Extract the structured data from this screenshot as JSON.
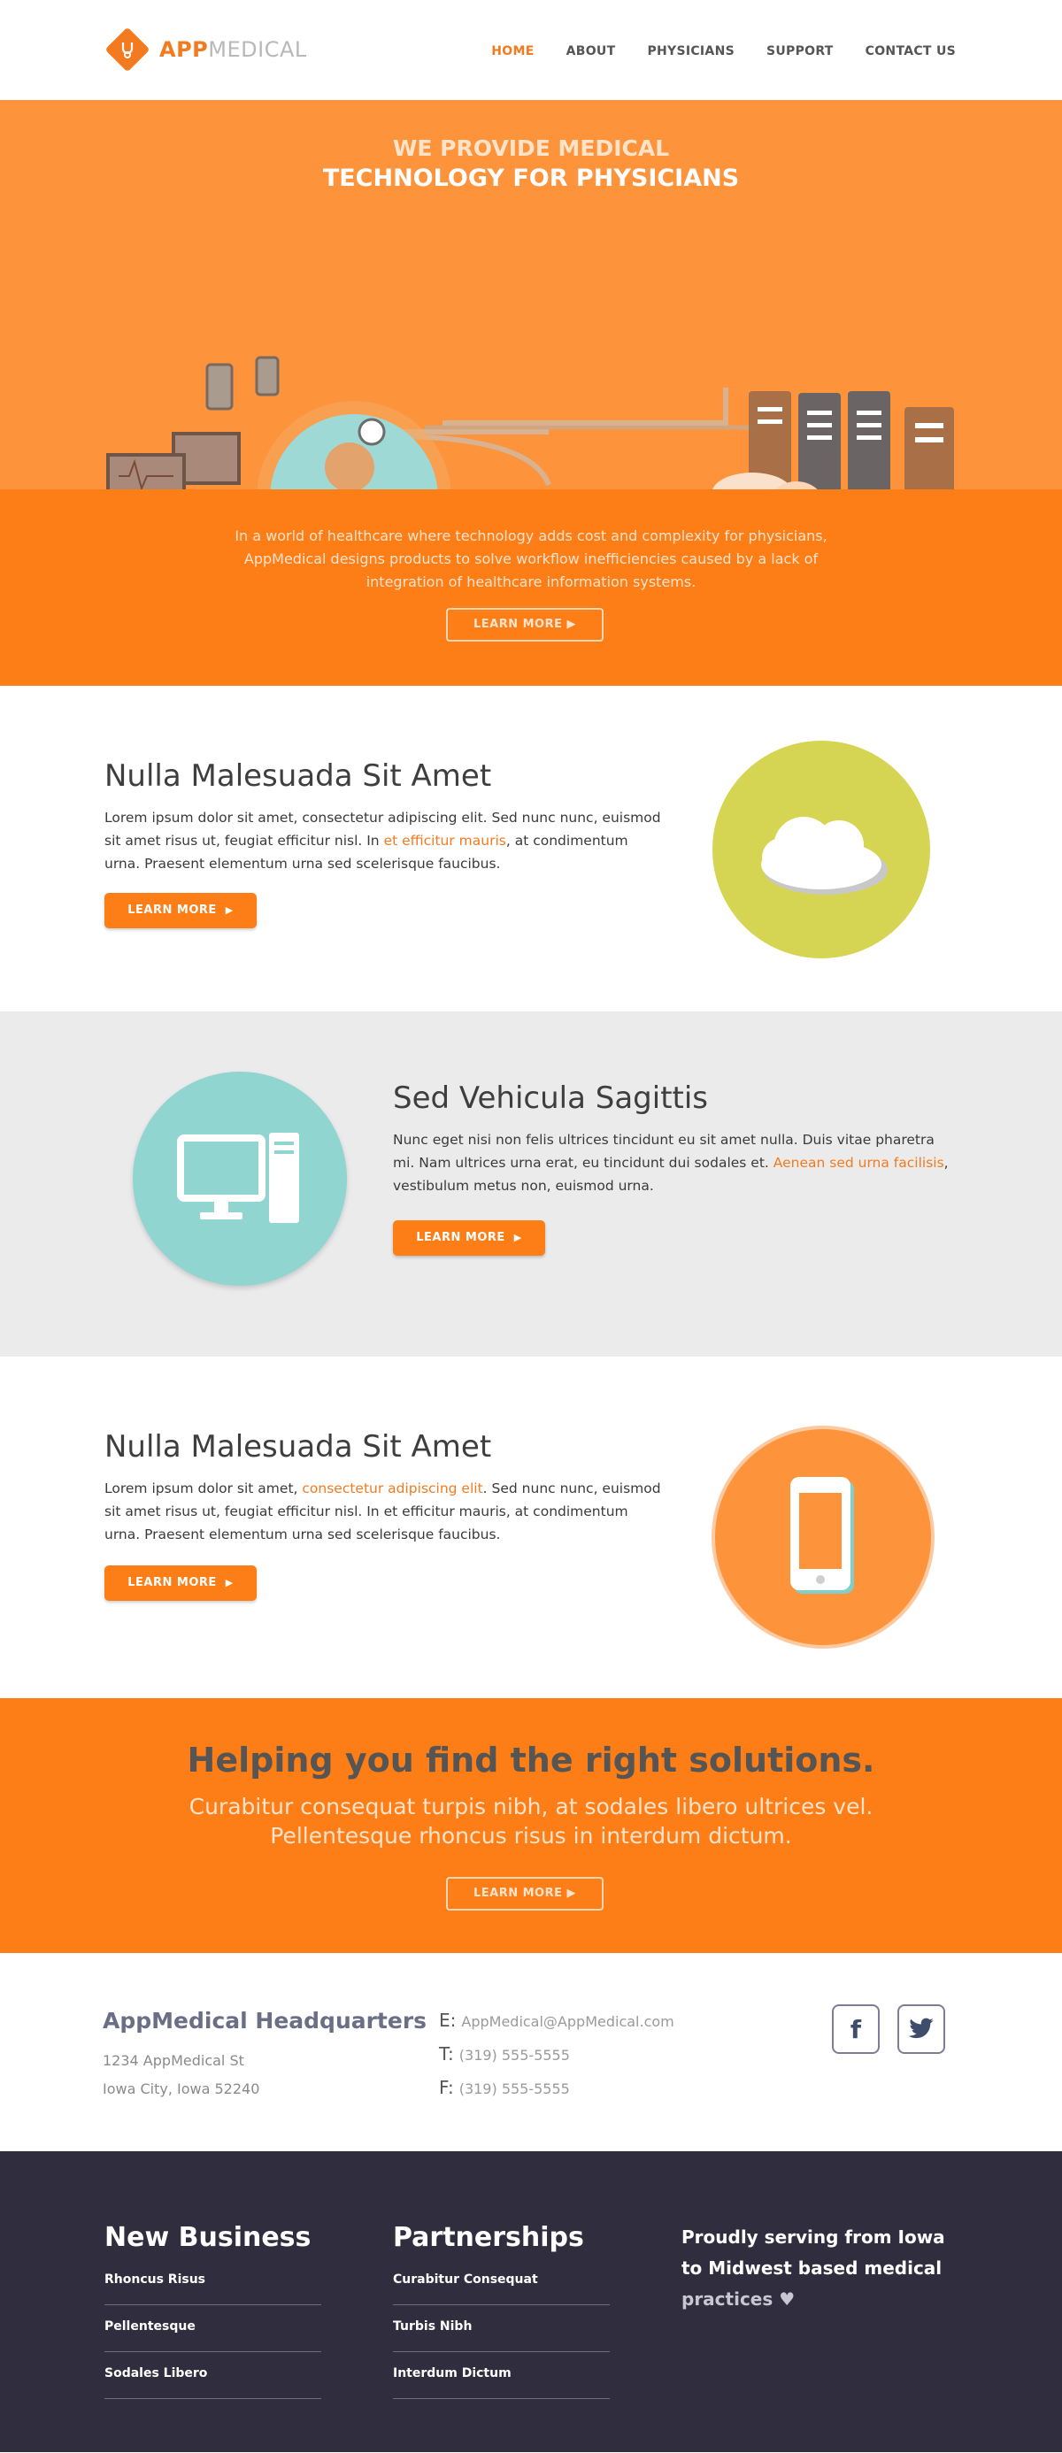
{
  "brand": {
    "name_a": "APP",
    "name_b": "MEDICAL",
    "accent": "#f47a1f"
  },
  "nav": [
    {
      "label": "HOME",
      "active": true
    },
    {
      "label": "ABOUT",
      "active": false
    },
    {
      "label": "PHYSICIANS",
      "active": false
    },
    {
      "label": "SUPPORT",
      "active": false
    },
    {
      "label": "CONTACT US",
      "active": false
    }
  ],
  "hero": {
    "line1": "WE PROVIDE MEDICAL",
    "line2": "TECHNOLOGY FOR PHYSICIANS",
    "body": "In a world of healthcare where technology adds cost and complexity for physicians, AppMedical designs products to solve workflow inefficiencies caused by a lack of integration of healthcare information systems.",
    "button": "LEARN MORE ▶"
  },
  "sections": [
    {
      "title": "Nulla Malesuada Sit Amet",
      "text_a": "Lorem ipsum dolor sit amet, consectetur adipiscing elit. Sed nunc nunc, euismod sit amet risus ut, feugiat efficitur nisl. In ",
      "text_hl": "et efficitur mauris",
      "text_b": ", at condimentum urna. Praesent elementum urna sed scelerisque faucibus.",
      "button": "LEARN MORE",
      "icon": "cloud-icon",
      "circle_color": "#d5d553"
    },
    {
      "title": "Sed Vehicula Sagittis",
      "text_a": "Nunc eget nisi non felis ultrices tincidunt eu sit amet nulla. Duis vitae pharetra mi. Nam ultrices urna erat, eu tincidunt dui sodales et. ",
      "text_hl": "Aenean sed urna facilisis",
      "text_b": ", vestibulum metus non, euismod urna.",
      "button": "LEARN MORE",
      "icon": "desktop-computer-icon",
      "circle_color": "#91d5d1"
    },
    {
      "title": "Nulla Malesuada Sit Amet",
      "text_a": "Lorem ipsum dolor sit amet, ",
      "text_hl": "consectetur adipiscing elit",
      "text_b": ". Sed nunc nunc, euismod sit amet risus ut, feugiat efficitur nisl. In et efficitur mauris, at condimentum urna. Praesent elementum urna sed scelerisque faucibus.",
      "button": "LEARN MORE",
      "icon": "smartphone-icon",
      "circle_color": "#fd933b"
    }
  ],
  "cta": {
    "title": "Helping you find the right solutions.",
    "sub_1": "Curabitur consequat turpis nibh, at sodales libero ultrices vel.",
    "sub_2": "Pellentesque rhoncus risus in interdum dictum.",
    "button": "LEARN MORE ▶"
  },
  "contact": {
    "hq": "AppMedical Headquarters",
    "street": "1234 AppMedical St",
    "city": "Iowa City, Iowa 52240",
    "email_label": "E:",
    "email": "AppMedical@AppMedical.com",
    "tel_label": "T:",
    "tel": "(319) 555-5555",
    "fax_label": "F:",
    "fax": "(319) 555-5555",
    "facebook": "f",
    "twitter": "twitter-bird"
  },
  "footer": {
    "col1_title": "New Business",
    "col1_items": [
      "Rhoncus Risus",
      "Pellentesque",
      "Sodales Libero"
    ],
    "col2_title": "Partnerships",
    "col2_items": [
      "Curabitur Consequat",
      "Turbis Nibh",
      "Interdum Dictum"
    ],
    "serve_1": "Proudly serving from Iowa",
    "serve_2": "to Midwest based medical",
    "serve_3": "practices ♥"
  }
}
